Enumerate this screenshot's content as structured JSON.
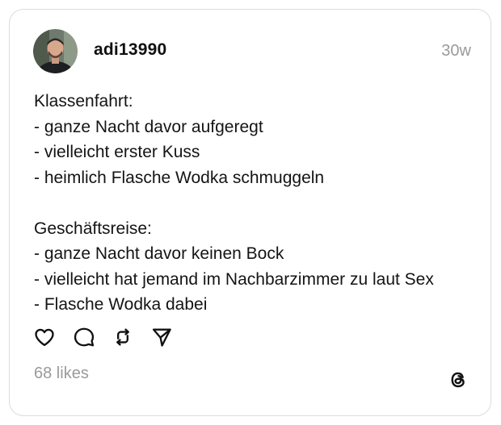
{
  "post": {
    "username": "adi13990",
    "timestamp": "30w",
    "text_lines": [
      "Klassenfahrt:",
      "- ganze Nacht davor aufgeregt",
      "- vielleicht erster Kuss",
      "- heimlich Flasche Wodka schmuggeln",
      "",
      "Geschäftsreise:",
      "- ganze Nacht davor keinen Bock",
      "- vielleicht hat jemand im Nachbarzimmer zu laut Sex",
      "- Flasche Wodka dabei"
    ],
    "likes": "68 likes"
  },
  "icons": {
    "like": "heart-icon",
    "comment": "speech-bubble-icon",
    "repost": "repost-icon",
    "share": "send-icon",
    "brand": "threads-logo-icon"
  },
  "colors": {
    "text": "#141414",
    "muted": "#9a9a9a",
    "border": "#dcdcdc",
    "background": "#ffffff"
  }
}
